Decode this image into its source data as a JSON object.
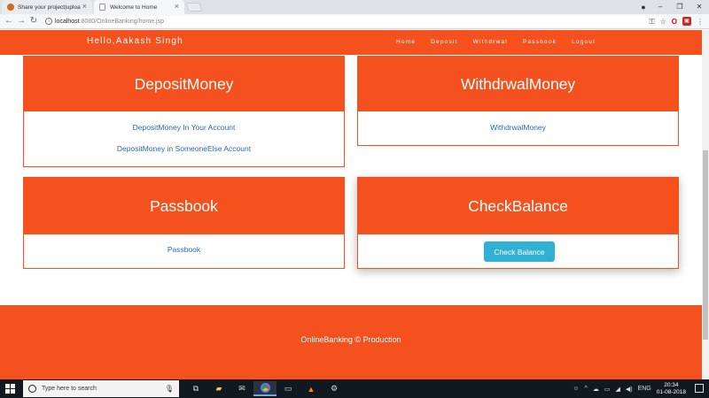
{
  "browser": {
    "tabs": [
      {
        "title": "Share your project|uploa"
      },
      {
        "title": "Welcome to Home"
      }
    ],
    "url_host": "localhost",
    "url_path": ":8080/OnlineBanking/home.jsp"
  },
  "navbar": {
    "greeting": "Hello,Aakash Singh",
    "links": [
      "Home",
      "Deposit",
      "Withdrwal",
      "Passbook",
      "Logout"
    ]
  },
  "cards": {
    "deposit": {
      "title": "DepositMoney",
      "links": [
        "DepositMoney In Your Account",
        "DepositMoney in SomeoneElse Account"
      ]
    },
    "withdraw": {
      "title": "WithdrwalMoney",
      "links": [
        "WithdrwalMoney"
      ]
    },
    "passbook": {
      "title": "Passbook",
      "links": [
        "Passbook"
      ]
    },
    "balance": {
      "title": "CheckBalance",
      "button": "Check Balance"
    }
  },
  "footer": {
    "text": "OnlineBanking © Production"
  },
  "taskbar": {
    "search_placeholder": "Type here to search",
    "language": "ENG",
    "time": "20:34",
    "date": "01-08-2018"
  },
  "colors": {
    "brand": "#f4511e",
    "button": "#31b0d5",
    "link": "#2a6bb0"
  }
}
